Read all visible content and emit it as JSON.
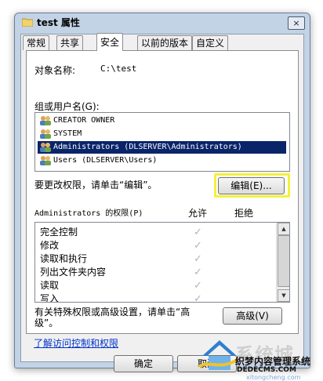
{
  "window": {
    "title": "test 属性",
    "close_label": "×"
  },
  "tabs": [
    {
      "label": "常规",
      "active": false
    },
    {
      "label": "共享",
      "active": false
    },
    {
      "label": "安全",
      "active": true
    },
    {
      "label": "以前的版本",
      "active": false
    },
    {
      "label": "自定义",
      "active": false
    }
  ],
  "security": {
    "object_name_label": "对象名称:",
    "object_name_value": "C:\\test",
    "groups_label": "组或用户名(G):",
    "groups": [
      {
        "name": "CREATOR OWNER",
        "selected": false
      },
      {
        "name": "SYSTEM",
        "selected": false
      },
      {
        "name": "Administrators (DLSERVER\\Administrators)",
        "selected": true
      },
      {
        "name": "Users (DLSERVER\\Users)",
        "selected": false
      }
    ],
    "edit_hint": "要更改权限，请单击“编辑”。",
    "edit_button": "编辑(E)...",
    "permissions_label": "Administrators 的权限(P)",
    "allow_header": "允许",
    "deny_header": "拒绝",
    "permissions": [
      {
        "name": "完全控制",
        "allow": "✓"
      },
      {
        "name": "修改",
        "allow": "✓"
      },
      {
        "name": "读取和执行",
        "allow": "✓"
      },
      {
        "name": "列出文件夹内容",
        "allow": "✓"
      },
      {
        "name": "读取",
        "allow": "✓"
      },
      {
        "name": "写入",
        "allow": "✓"
      }
    ],
    "special_hint_line1": "有关特殊权限或高级设置，请单击“高",
    "special_hint_line2": "级”。",
    "advanced_button": "高级(V)",
    "learn_link": "了解访问控制和权限"
  },
  "footer": {
    "ok_button": "确定",
    "cancel_button": "取消"
  },
  "watermark": {
    "brand": "系统城",
    "line1": "织梦内容管理系统",
    "line2": "DEDECMS.COM",
    "line3": "xitongcheng.com"
  },
  "colors": {
    "selection": "#0a246a",
    "highlight_box": "#f4f03c",
    "link": "#0033cc",
    "frame": "#c3d3e6"
  }
}
